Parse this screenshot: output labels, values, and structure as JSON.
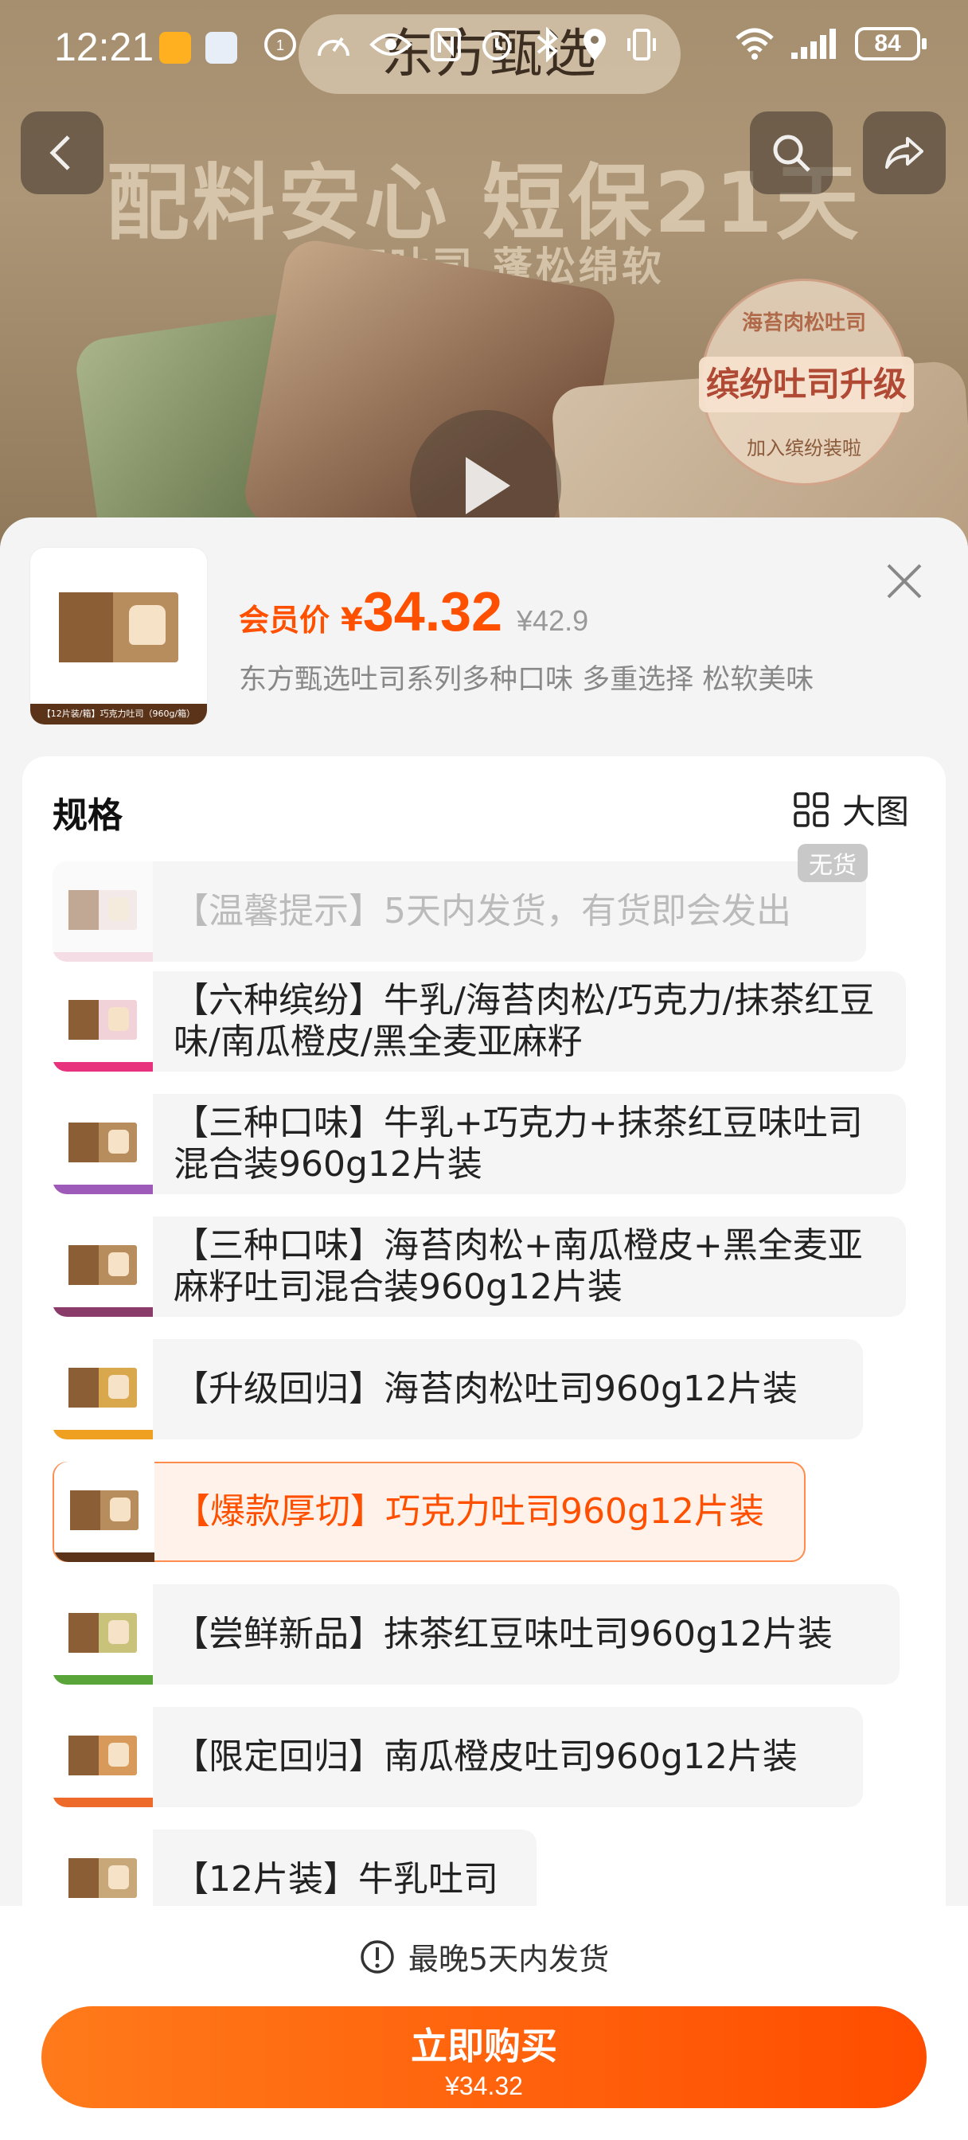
{
  "status_bar": {
    "time": "12:21",
    "battery": "84"
  },
  "banner": {
    "brand": "东方甄选",
    "headline": "配料安心 短保21天",
    "subline": "厚切吐司 蓬松绵软",
    "badge_top": "海苔肉松吐司",
    "badge_main": "缤纷吐司升级",
    "badge_bottom": "加入缤纷装啦"
  },
  "product": {
    "thumb_caption": "【12片装/箱】巧克力吐司（960g/箱）",
    "member_label": "会员价",
    "currency": "¥",
    "price": "34.32",
    "original_price": "¥42.9",
    "description": "东方甄选吐司系列多种口味 多重选择 松软美味"
  },
  "spec": {
    "title": "规格",
    "big_view_label": "大图",
    "options": [
      {
        "label": "【温馨提示】5天内发货，有货即会发出",
        "tag": "无货"
      },
      {
        "label": "【六种缤纷】牛乳/海苔肉松/巧克力/抹茶红豆味/南瓜橙皮/黑全麦亚麻籽"
      },
      {
        "label": "【三种口味】牛乳+巧克力+抹茶红豆味吐司混合装960g12片装"
      },
      {
        "label": "【三种口味】海苔肉松+南瓜橙皮+黑全麦亚麻籽吐司混合装960g12片装"
      },
      {
        "label": "【升级回归】海苔肉松吐司960g12片装"
      },
      {
        "label": "【爆款厚切】巧克力吐司960g12片装"
      },
      {
        "label": "【尝鲜新品】抹茶红豆味吐司960g12片装"
      },
      {
        "label": "【限定回归】南瓜橙皮吐司960g12片装"
      },
      {
        "label": "【12片装】牛乳吐司"
      }
    ]
  },
  "footer": {
    "shipping_note": "最晚5天内发货",
    "buy_label": "立即购买",
    "buy_price": "¥34.32"
  },
  "colors": {
    "accent": "#ff5000",
    "selected_bg": "#fff2ea",
    "selected_border": "#ff8c4d"
  }
}
